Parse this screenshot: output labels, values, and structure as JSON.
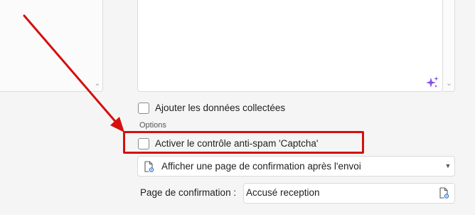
{
  "checkboxes": {
    "collected_data": {
      "label": "Ajouter les données collectées",
      "checked": false
    },
    "captcha": {
      "label": "Activer le contrôle anti-spam 'Captcha'",
      "checked": false
    }
  },
  "options_section": {
    "label": "Options"
  },
  "confirmation_dropdown": {
    "selected": "Afficher une page de confirmation après l'envoi",
    "icon": "page-settings-icon"
  },
  "confirmation_page": {
    "label": "Page de confirmation :",
    "value": "Accusé reception",
    "icon": "page-settings-icon"
  },
  "annotation": {
    "color": "#d60f0f"
  }
}
